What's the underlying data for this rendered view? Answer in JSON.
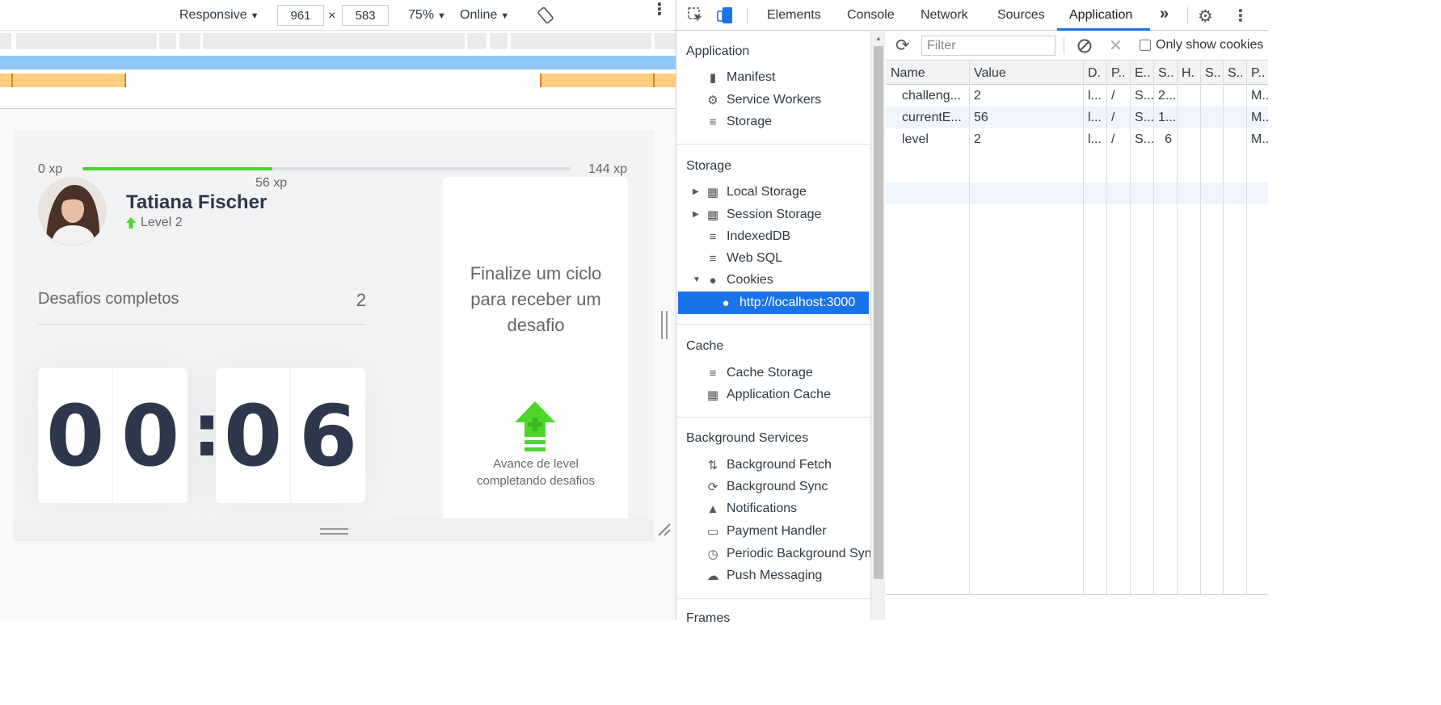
{
  "device_toolbar": {
    "device": "Responsive",
    "width": "961",
    "times": "×",
    "height": "583",
    "zoom": "75%",
    "network": "Online"
  },
  "app": {
    "xp_start": "0 xp",
    "xp_current": "56 xp",
    "xp_end": "144 xp",
    "xp_progress_fraction": 0.389,
    "user_name": "Tatiana Fischer",
    "level": "Level 2",
    "challenges_label": "Desafios completos",
    "challenges_count": "2",
    "countdown": {
      "m1": "0",
      "m2": "0",
      "colon": ":",
      "s1": "0",
      "s2": "6"
    },
    "challenge_title": "Finalize um ciclo para receber um desafio",
    "challenge_hint": "Avance de level completando desafios",
    "accent_color": "#4cd62b"
  },
  "devtools": {
    "tabs": [
      "Elements",
      "Console",
      "Network",
      "Sources",
      "Application"
    ],
    "active_tab": "Application",
    "more_tabs": "»",
    "sidebar": {
      "application_header": "Application",
      "application_items": [
        {
          "label": "Manifest",
          "icon": "file-icon"
        },
        {
          "label": "Service Workers",
          "icon": "gear-icon"
        },
        {
          "label": "Storage",
          "icon": "database-icon"
        }
      ],
      "storage_header": "Storage",
      "storage_items": [
        {
          "label": "Local Storage",
          "icon": "grid-icon"
        },
        {
          "label": "Session Storage",
          "icon": "grid-icon"
        },
        {
          "label": "IndexedDB",
          "icon": "database-icon"
        },
        {
          "label": "Web SQL",
          "icon": "database-icon"
        },
        {
          "label": "Cookies",
          "icon": "cookie-icon"
        }
      ],
      "cookie_origin": "http://localhost:3000",
      "cache_header": "Cache",
      "cache_items": [
        {
          "label": "Cache Storage",
          "icon": "database-icon"
        },
        {
          "label": "Application Cache",
          "icon": "grid-icon"
        }
      ],
      "bg_header": "Background Services",
      "bg_items": [
        {
          "label": "Background Fetch",
          "icon": "updown-icon"
        },
        {
          "label": "Background Sync",
          "icon": "sync-icon"
        },
        {
          "label": "Notifications",
          "icon": "bell-icon"
        },
        {
          "label": "Payment Handler",
          "icon": "card-icon"
        },
        {
          "label": "Periodic Background Syn",
          "icon": "clock-icon"
        },
        {
          "label": "Push Messaging",
          "icon": "cloud-icon"
        }
      ],
      "frames_header": "Frames"
    },
    "cookies": {
      "filter_placeholder": "Filter",
      "only_show_label": "Only show cookies",
      "columns": [
        "Name",
        "Value",
        "D.",
        "P..",
        "E..",
        "S..",
        "H.",
        "S..",
        "S..",
        "P.."
      ],
      "rows": [
        [
          "challeng...",
          "2",
          "l...",
          "/",
          "S...",
          "2...",
          "",
          "",
          "",
          "M..."
        ],
        [
          "currentE...",
          "56",
          "l...",
          "/",
          "S...",
          "1...",
          "",
          "",
          "",
          "M..."
        ],
        [
          "level",
          "2",
          "l...",
          "/",
          "S...",
          "6",
          "",
          "",
          "",
          "M..."
        ]
      ]
    }
  }
}
